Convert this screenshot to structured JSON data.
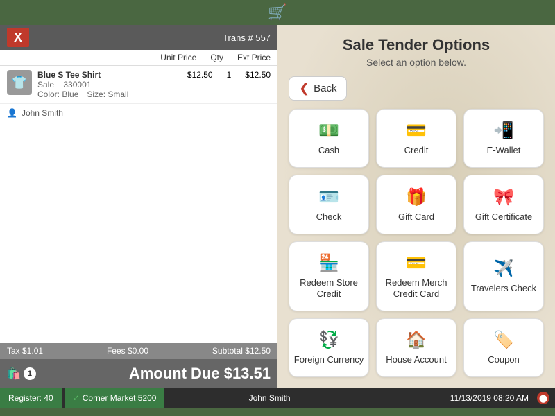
{
  "topBar": {
    "cartIcon": "🛒"
  },
  "leftPanel": {
    "xLogo": "X",
    "transLabel": "Trans #",
    "transNumber": "557",
    "columns": {
      "unitPrice": "Unit Price",
      "qty": "Qty",
      "extPrice": "Ext Price"
    },
    "item": {
      "name": "Blue S Tee Shirt",
      "type": "Sale",
      "sku": "330001",
      "color": "Color: Blue",
      "size": "Size: Small",
      "unitPrice": "$12.50",
      "qty": "1",
      "extPrice": "$12.50",
      "icon": "👕"
    },
    "customer": "John Smith",
    "footer": {
      "tax": "Tax $1.01",
      "fees": "Fees $0.00",
      "subtotal": "Subtotal $12.50"
    },
    "amountDue": "Amount Due $13.51",
    "bagCount": "1"
  },
  "rightPanel": {
    "title": "Sale Tender Options",
    "subtitle": "Select an option below.",
    "backLabel": "Back",
    "options": [
      {
        "id": "cash",
        "label": "Cash",
        "icon": "💵"
      },
      {
        "id": "credit",
        "label": "Credit",
        "icon": "💳"
      },
      {
        "id": "ewallet",
        "label": "E-Wallet",
        "icon": "📲"
      },
      {
        "id": "check",
        "label": "Check",
        "icon": "🪪"
      },
      {
        "id": "giftcard",
        "label": "Gift Card",
        "icon": "🎁"
      },
      {
        "id": "giftcert",
        "label": "Gift Certificate",
        "icon": "🎀"
      },
      {
        "id": "redeemstore",
        "label": "Redeem Store Credit",
        "icon": "🏪"
      },
      {
        "id": "redeemmerch",
        "label": "Redeem Merch Credit Card",
        "icon": "💳"
      },
      {
        "id": "travelerscheck",
        "label": "Travelers Check",
        "icon": "✈️"
      },
      {
        "id": "foreigncurrency",
        "label": "Foreign Currency",
        "icon": "💱"
      },
      {
        "id": "houseaccount",
        "label": "House Account",
        "icon": "🏠"
      },
      {
        "id": "coupon",
        "label": "Coupon",
        "icon": "🏷️"
      }
    ]
  },
  "statusBar": {
    "register": "Register: 40",
    "store": "Corner Market 5200",
    "cashier": "John Smith",
    "datetime": "11/13/2019 08:20 AM",
    "checkIcon": "✓"
  }
}
